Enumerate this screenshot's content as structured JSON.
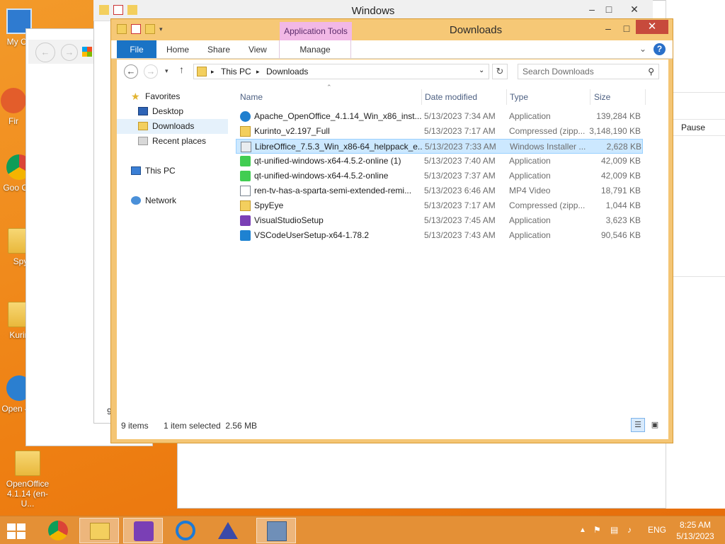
{
  "desktop": {
    "icons": [
      {
        "label": "My Co"
      },
      {
        "label": "Fir"
      },
      {
        "label": "Goo Chr"
      },
      {
        "label": "Spy"
      },
      {
        "label": "Kurint"
      },
      {
        "label": "Open 4.1"
      },
      {
        "label": "OpenOffice 4.1.14 (en-U..."
      }
    ]
  },
  "background_window": {
    "title": "Windows",
    "column_pause": "Pause",
    "partial_digit": "9"
  },
  "explorer": {
    "title": "Downloads",
    "contextual_tab_group": "Application Tools",
    "tabs": [
      "File",
      "Home",
      "Share",
      "View",
      "Manage"
    ],
    "address": {
      "root": "This PC",
      "current": "Downloads"
    },
    "search": {
      "placeholder": "Search Downloads"
    },
    "nav": {
      "favorites": "Favorites",
      "desktop": "Desktop",
      "downloads": "Downloads",
      "recent": "Recent places",
      "this_pc": "This PC",
      "network": "Network"
    },
    "columns": {
      "name": "Name",
      "date": "Date modified",
      "type": "Type",
      "size": "Size"
    },
    "files": [
      {
        "name": "Apache_OpenOffice_4.1.14_Win_x86_inst...",
        "date": "5/13/2023 7:34 AM",
        "type": "Application",
        "size": "139,284 KB",
        "icon": "openoffice-icon"
      },
      {
        "name": "Kurinto_v2.197_Full",
        "date": "5/13/2023 7:17 AM",
        "type": "Compressed (zipp...",
        "size": "3,148,190 KB",
        "icon": "zip-folder-icon"
      },
      {
        "name": "LibreOffice_7.5.3_Win_x86-64_helppack_e...",
        "date": "5/13/2023 7:33 AM",
        "type": "Windows Installer ...",
        "size": "2,628 KB",
        "icon": "msi-installer-icon"
      },
      {
        "name": "qt-unified-windows-x64-4.5.2-online (1)",
        "date": "5/13/2023 7:40 AM",
        "type": "Application",
        "size": "42,009 KB",
        "icon": "qt-icon"
      },
      {
        "name": "qt-unified-windows-x64-4.5.2-online",
        "date": "5/13/2023 7:37 AM",
        "type": "Application",
        "size": "42,009 KB",
        "icon": "qt-icon"
      },
      {
        "name": "ren-tv-has-a-sparta-semi-extended-remi...",
        "date": "5/13/2023 6:46 AM",
        "type": "MP4 Video",
        "size": "18,791 KB",
        "icon": "video-file-icon"
      },
      {
        "name": "SpyEye",
        "date": "5/13/2023 7:17 AM",
        "type": "Compressed (zipp...",
        "size": "1,044 KB",
        "icon": "zip-folder-icon"
      },
      {
        "name": "VisualStudioSetup",
        "date": "5/13/2023 7:45 AM",
        "type": "Application",
        "size": "3,623 KB",
        "icon": "visual-studio-icon"
      },
      {
        "name": "VSCodeUserSetup-x64-1.78.2",
        "date": "5/13/2023 7:43 AM",
        "type": "Application",
        "size": "90,546 KB",
        "icon": "vscode-icon"
      }
    ],
    "selected_index": 2,
    "status": {
      "count": "9 items",
      "selection": "1 item selected  2.56 MB"
    }
  },
  "taskbar": {
    "language": "ENG",
    "time": "8:25 AM",
    "date": "5/13/2023"
  },
  "colors": {
    "desktop_orange": "#ee7f12",
    "explorer_frame": "#f4c574",
    "file_tab_blue": "#1a73c5",
    "close_red": "#c74a3c",
    "selection_blue": "#cce8ff"
  }
}
